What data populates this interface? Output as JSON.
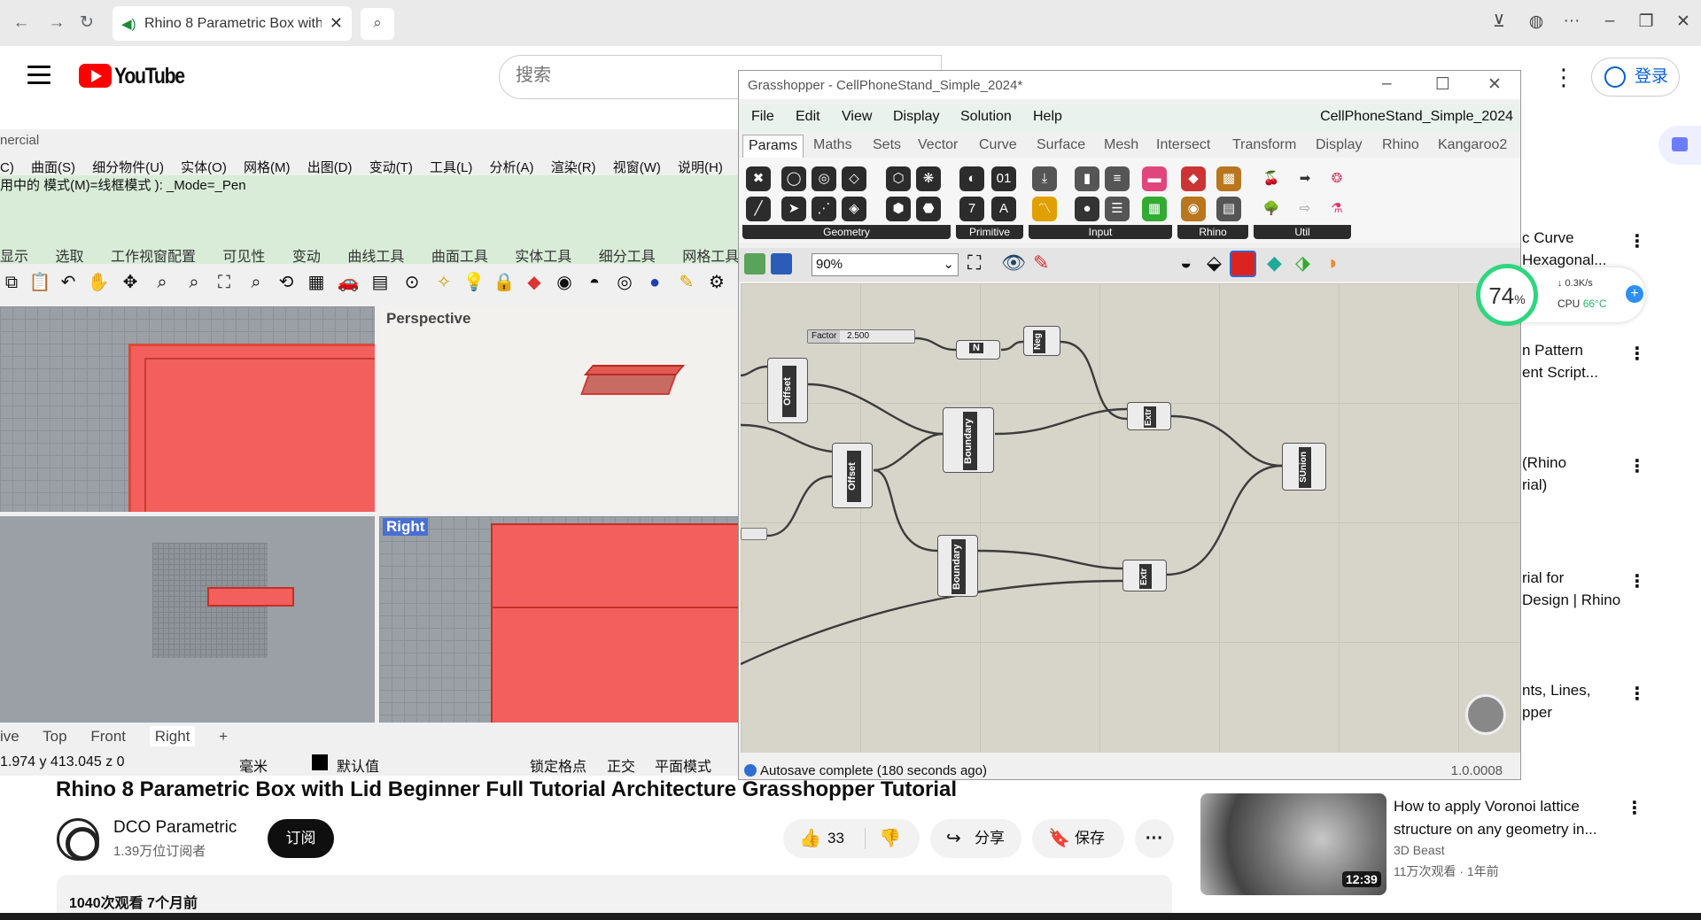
{
  "browser": {
    "tab_title": "Rhino 8 Parametric Box with",
    "tab_close": "✕"
  },
  "youtube": {
    "logo_text": "YouTube",
    "search_placeholder": "搜索",
    "login_label": "登录"
  },
  "rhino": {
    "title": "nercial",
    "menu": [
      "C)",
      "曲面(S)",
      "细分物件(U)",
      "实体(O)",
      "网格(M)",
      "出图(D)",
      "变动(T)",
      "工具(L)",
      "分析(A)",
      "渲染(R)",
      "视窗(W)",
      "说明(H)"
    ],
    "command_line": "用中的  模式(M)=线框模式 ): _Mode=_Pen",
    "tabs": [
      "显示",
      "选取",
      "工作视窗配置",
      "可见性",
      "变动",
      "曲线工具",
      "曲面工具",
      "实体工具",
      "细分工具",
      "网格工具"
    ],
    "viewports": {
      "perspective": "Perspective",
      "right": "Right"
    },
    "viewport_tabs": [
      "ive",
      "Top",
      "Front",
      "Right"
    ],
    "status": {
      "coords": "1.974   y 413.045   z 0",
      "units": "毫米",
      "layer": "默认值",
      "snap": "锁定格点",
      "ortho": "正交",
      "planar": "平面模式"
    }
  },
  "grasshopper": {
    "title": "Grasshopper - CellPhoneStand_Simple_2024*",
    "menu": [
      "File",
      "Edit",
      "View",
      "Display",
      "Solution",
      "Help"
    ],
    "document_name": "CellPhoneStand_Simple_2024",
    "tabs": [
      "Params",
      "Maths",
      "Sets",
      "Vector",
      "Curve",
      "Surface",
      "Mesh",
      "Intersect",
      "Transform",
      "Display",
      "Rhino",
      "Kangaroo2"
    ],
    "ribbon_groups": [
      "Geometry",
      "Primitive",
      "Input",
      "Rhino",
      "Util"
    ],
    "zoom": "90%",
    "nodes": {
      "factor_label": "Factor",
      "factor_value": "2.500",
      "offset": "Offset",
      "boundary": "Boundary",
      "extrude": "Extr",
      "negative": "Neg",
      "sunion": "SUnion",
      "n": "N"
    },
    "status_message": "Autosave complete (180 seconds ago)",
    "version": "1.0.0008"
  },
  "cpu_widget": {
    "percent": "74",
    "percent_sign": "%",
    "speed": "↓ 0.3K/s",
    "cpu_label": "CPU",
    "temperature": "66°C"
  },
  "video": {
    "title": "Rhino 8 Parametric Box with Lid Beginner Full Tutorial Architecture Grasshopper Tutorial",
    "channel": "DCO Parametric",
    "subscribers": "1.39万位订阅者",
    "subscribe": "订阅",
    "likes": "33",
    "share": "分享",
    "save": "保存",
    "views_date": "1040次观看  7个月前"
  },
  "recommendations": [
    {
      "title_line1": "c Curve",
      "title_line2": "Hexagonal..."
    },
    {
      "title_line1": "n Pattern",
      "title_line2": "ent Script..."
    },
    {
      "title_line1": "(Rhino",
      "title_line2": "rial)"
    },
    {
      "title_line1": "rial for",
      "title_line2": "Design | Rhino"
    },
    {
      "title_line1": "nts, Lines,",
      "title_line2": "pper"
    }
  ],
  "voronoi_rec": {
    "title": "How to apply Voronoi lattice structure on any geometry in...",
    "channel": "3D Beast",
    "meta": "11万次观看 · 1年前",
    "duration": "12:39"
  }
}
